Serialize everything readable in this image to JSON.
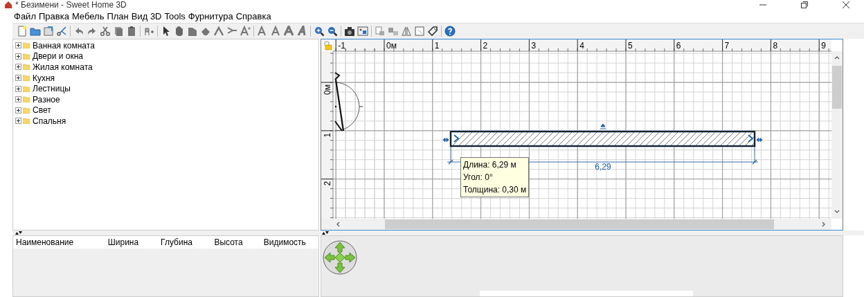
{
  "window": {
    "title": "* Безимени - Sweet Home 3D"
  },
  "menu": [
    "Файл",
    "Правка",
    "Мебель",
    "План",
    "Вид 3D",
    "Tools",
    "Фурнитура",
    "Справка"
  ],
  "catalog": [
    {
      "label": "Ванная комната",
      "expanded": false
    },
    {
      "label": "Двери и окна",
      "expanded": false
    },
    {
      "label": "Жилая комната",
      "expanded": false
    },
    {
      "label": "Кухня",
      "expanded": false
    },
    {
      "label": "Лестницы",
      "expanded": false
    },
    {
      "label": "Разное",
      "expanded": false
    },
    {
      "label": "Свет",
      "expanded": false
    },
    {
      "label": "Спальня",
      "expanded": false
    }
  ],
  "plan": {
    "x_ruler": [
      "-1",
      "0м",
      "1",
      "2",
      "3",
      "4",
      "5",
      "6",
      "7",
      "8",
      "9"
    ],
    "y_ruler": [
      "0м",
      "1",
      "2"
    ],
    "wall_dimension": "6,29",
    "tooltip": [
      "Длина: 6,29 м",
      "Угол: 0°",
      "Толщина: 0,30 м"
    ]
  },
  "furniture_table": {
    "columns": [
      "Наименование",
      "Ширина",
      "Глубина",
      "Высота",
      "Видимость"
    ]
  }
}
